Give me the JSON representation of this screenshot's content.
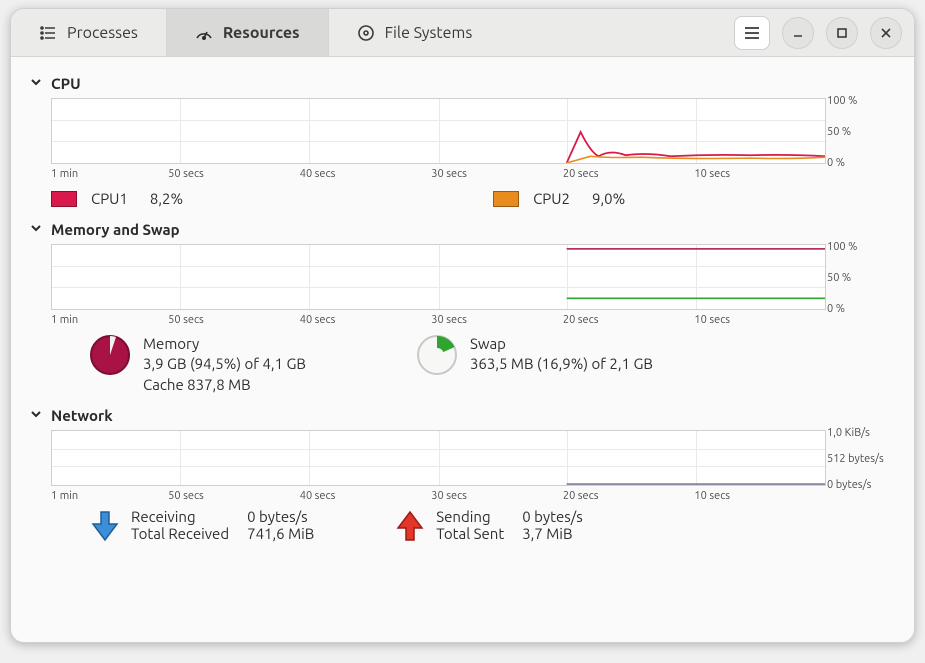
{
  "tabs": {
    "processes": "Processes",
    "resources": "Resources",
    "filesystems": "File Systems"
  },
  "sections": {
    "cpu": "CPU",
    "mem": "Memory and Swap",
    "net": "Network"
  },
  "x_ticks": [
    "1 min",
    "50 secs",
    "40 secs",
    "30 secs",
    "20 secs",
    "10 secs"
  ],
  "cpu": {
    "y_ticks": [
      "100 %",
      "50 %",
      "0 %"
    ],
    "legend": {
      "cpu1_label": "CPU1",
      "cpu1_value": "8,2%",
      "cpu2_label": "CPU2",
      "cpu2_value": "9,0%"
    }
  },
  "chart_data": [
    {
      "type": "line",
      "title": "CPU",
      "x_unit": "seconds ago",
      "x_range": [
        60,
        0
      ],
      "ylabel": "%",
      "ylim": [
        0,
        100
      ],
      "series": [
        {
          "name": "CPU1",
          "color": "#d9184b",
          "x": [
            20,
            18,
            17,
            16,
            14,
            12,
            10,
            8,
            6,
            4,
            2,
            0
          ],
          "y": [
            0,
            50,
            22,
            10,
            14,
            9,
            11,
            8,
            10,
            8,
            9,
            8
          ]
        },
        {
          "name": "CPU2",
          "color": "#e88c1e",
          "x": [
            20,
            18,
            16,
            14,
            12,
            10,
            8,
            6,
            4,
            2,
            0
          ],
          "y": [
            0,
            12,
            8,
            10,
            7,
            9,
            7,
            8,
            7,
            9,
            9
          ]
        }
      ]
    },
    {
      "type": "line",
      "title": "Memory and Swap",
      "x_unit": "seconds ago",
      "x_range": [
        60,
        0
      ],
      "ylabel": "%",
      "ylim": [
        0,
        100
      ],
      "series": [
        {
          "name": "Memory",
          "color": "#a81244",
          "x": [
            20,
            0
          ],
          "y": [
            94.5,
            94.5
          ]
        },
        {
          "name": "Swap",
          "color": "#2fa52f",
          "x": [
            20,
            0
          ],
          "y": [
            16.9,
            16.9
          ]
        }
      ]
    },
    {
      "type": "line",
      "title": "Network",
      "x_unit": "seconds ago",
      "x_range": [
        60,
        0
      ],
      "ylabel": "bytes/s",
      "ylim": [
        0,
        1024
      ],
      "series": [
        {
          "name": "Receiving",
          "color": "#3a7fbf",
          "x": [
            20,
            0
          ],
          "y": [
            0,
            0
          ]
        },
        {
          "name": "Sending",
          "color": "#cc2a1f",
          "x": [
            20,
            0
          ],
          "y": [
            0,
            0
          ]
        }
      ]
    }
  ],
  "mem": {
    "y_ticks": [
      "100 %",
      "50 %",
      "0 %"
    ],
    "memory": {
      "title": "Memory",
      "line1": "3,9 GB (94,5%) of 4,1 GB",
      "line2": "Cache 837,8 MB",
      "used_pct": 94.5,
      "color": "#a81244"
    },
    "swap": {
      "title": "Swap",
      "line1": "363,5 MB (16,9%) of 2,1 GB",
      "used_pct": 16.9,
      "color": "#2fa52f"
    }
  },
  "net": {
    "y_ticks": [
      "1,0 KiB/s",
      "512 bytes/s",
      "0 bytes/s"
    ],
    "recv": {
      "label": "Receiving",
      "rate": "0 bytes/s",
      "total_label": "Total Received",
      "total_value": "741,6 MiB",
      "color": "#3a7fbf"
    },
    "send": {
      "label": "Sending",
      "rate": "0 bytes/s",
      "total_label": "Total Sent",
      "total_value": "3,7 MiB",
      "color": "#cc2a1f"
    }
  }
}
